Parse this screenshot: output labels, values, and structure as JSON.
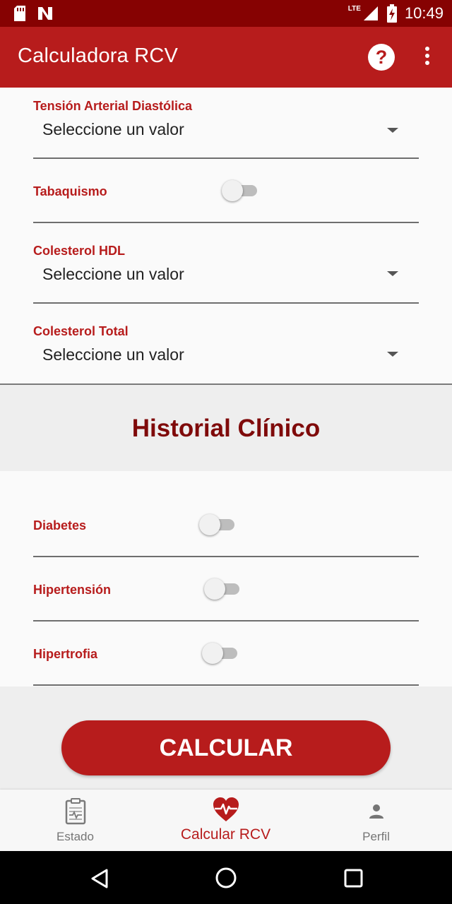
{
  "status_bar": {
    "time": "10:49",
    "network": "LTE",
    "left_icons": [
      "sd-card-icon",
      "n-notification-icon"
    ],
    "right_icons": [
      "signal-icon",
      "battery-icon"
    ]
  },
  "app_bar": {
    "title": "Calculadora RCV",
    "help_label": "?",
    "icons": [
      "help-icon",
      "more-vert-icon"
    ]
  },
  "form": {
    "fields": [
      {
        "type": "select",
        "label": "Tensión Arterial Diastólica",
        "value": "Seleccione un valor"
      },
      {
        "type": "switch",
        "label": "Tabaquismo",
        "checked": false
      },
      {
        "type": "select",
        "label": "Colesterol HDL",
        "value": "Seleccione un valor"
      },
      {
        "type": "select",
        "label": "Colesterol Total",
        "value": "Seleccione un valor"
      }
    ]
  },
  "history": {
    "title": "Historial Clínico",
    "fields": [
      {
        "type": "switch",
        "label": "Diabetes",
        "checked": false
      },
      {
        "type": "switch",
        "label": "Hipertensión",
        "checked": false
      },
      {
        "type": "switch",
        "label": "Hipertrofia",
        "checked": false
      }
    ]
  },
  "calc_button": {
    "label": "CALCULAR"
  },
  "bottom_nav": {
    "items": [
      {
        "label": "Estado",
        "icon": "clipboard-pulse-icon",
        "active": false
      },
      {
        "label": "Calcular RCV",
        "icon": "heart-pulse-icon",
        "active": true
      },
      {
        "label": "Perfil",
        "icon": "person-icon",
        "active": false
      }
    ]
  },
  "colors": {
    "status_bar": "#860202",
    "primary": "#b71c1c",
    "title_dark_red": "#7f0a0a",
    "inactive_nav": "#757575"
  },
  "system_nav": {
    "icons": [
      "back-icon",
      "home-icon",
      "recents-icon"
    ]
  }
}
